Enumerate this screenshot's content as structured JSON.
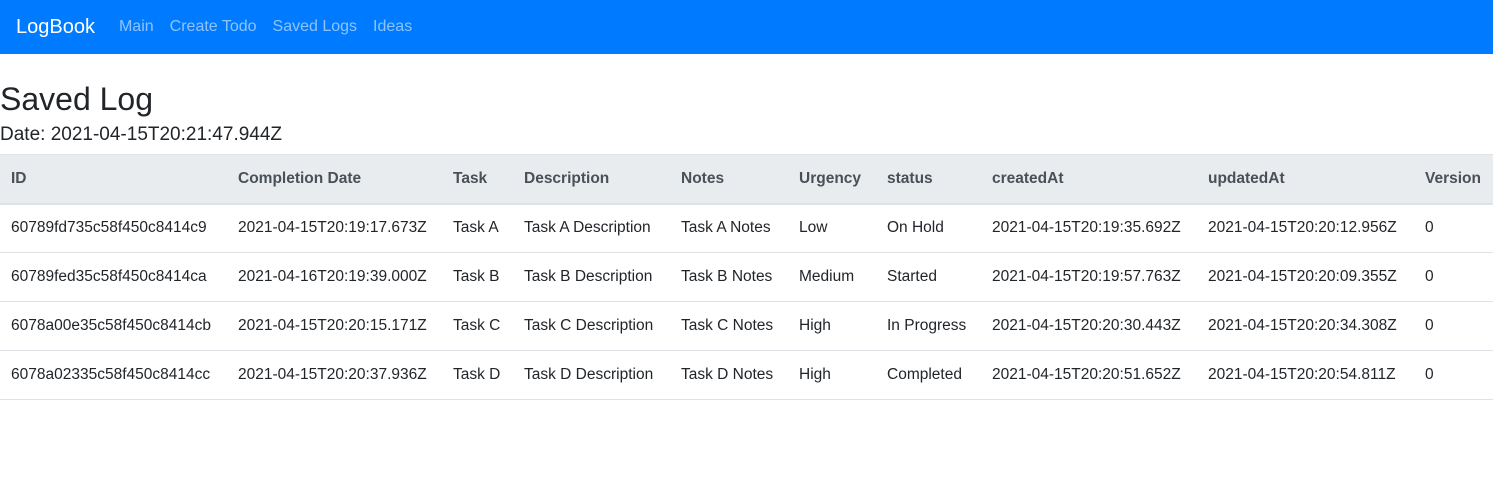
{
  "navbar": {
    "brand": "LogBook",
    "links": [
      "Main",
      "Create Todo",
      "Saved Logs",
      "Ideas"
    ]
  },
  "page": {
    "title": "Saved Log",
    "date_line": "Date: 2021-04-15T20:21:47.944Z"
  },
  "table": {
    "headers": [
      "ID",
      "Completion Date",
      "Task",
      "Description",
      "Notes",
      "Urgency",
      "status",
      "createdAt",
      "updatedAt",
      "Version"
    ],
    "rows": [
      [
        "60789fd735c58f450c8414c9",
        "2021-04-15T20:19:17.673Z",
        "Task A",
        "Task A Description",
        "Task A Notes",
        "Low",
        "On Hold",
        "2021-04-15T20:19:35.692Z",
        "2021-04-15T20:20:12.956Z",
        "0"
      ],
      [
        "60789fed35c58f450c8414ca",
        "2021-04-16T20:19:39.000Z",
        "Task B",
        "Task B Description",
        "Task B Notes",
        "Medium",
        "Started",
        "2021-04-15T20:19:57.763Z",
        "2021-04-15T20:20:09.355Z",
        "0"
      ],
      [
        "6078a00e35c58f450c8414cb",
        "2021-04-15T20:20:15.171Z",
        "Task C",
        "Task C Description",
        "Task C Notes",
        "High",
        "In Progress",
        "2021-04-15T20:20:30.443Z",
        "2021-04-15T20:20:34.308Z",
        "0"
      ],
      [
        "6078a02335c58f450c8414cc",
        "2021-04-15T20:20:37.936Z",
        "Task D",
        "Task D Description",
        "Task D Notes",
        "High",
        "Completed",
        "2021-04-15T20:20:51.652Z",
        "2021-04-15T20:20:54.811Z",
        "0"
      ]
    ]
  },
  "colors": {
    "navbar_bg": "#007bff",
    "header_bg": "#e9ecef"
  }
}
